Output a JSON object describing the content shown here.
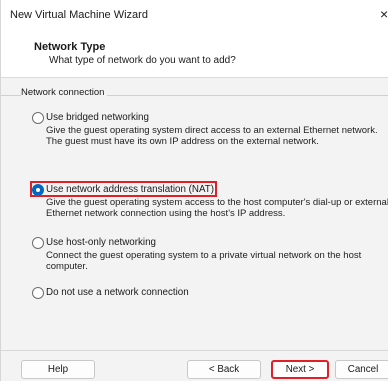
{
  "window": {
    "title": "New Virtual Machine Wizard",
    "close_glyph": "×"
  },
  "header": {
    "title": "Network Type",
    "subtitle": "What type of network do you want to add?"
  },
  "group": {
    "label": "Network connection"
  },
  "options": [
    {
      "label": "Use bridged networking",
      "description": "Give the guest operating system direct access to an external Ethernet network. The guest must have its own IP address on the external network.",
      "selected": false
    },
    {
      "label": "Use network address translation (NAT)",
      "description": "Give the guest operating system access to the host computer's dial-up or external Ethernet network connection using the host's IP address.",
      "selected": true
    },
    {
      "label": "Use host-only networking",
      "description": "Connect the guest operating system to a private virtual network on the host computer.",
      "selected": false
    },
    {
      "label": "Do not use a network connection",
      "description": "",
      "selected": false
    }
  ],
  "buttons": {
    "help": "Help",
    "back": "< Back",
    "next": "Next >",
    "cancel": "Cancel"
  },
  "colors": {
    "highlight": "#e01f26",
    "radio_selected": "#0067c0"
  }
}
